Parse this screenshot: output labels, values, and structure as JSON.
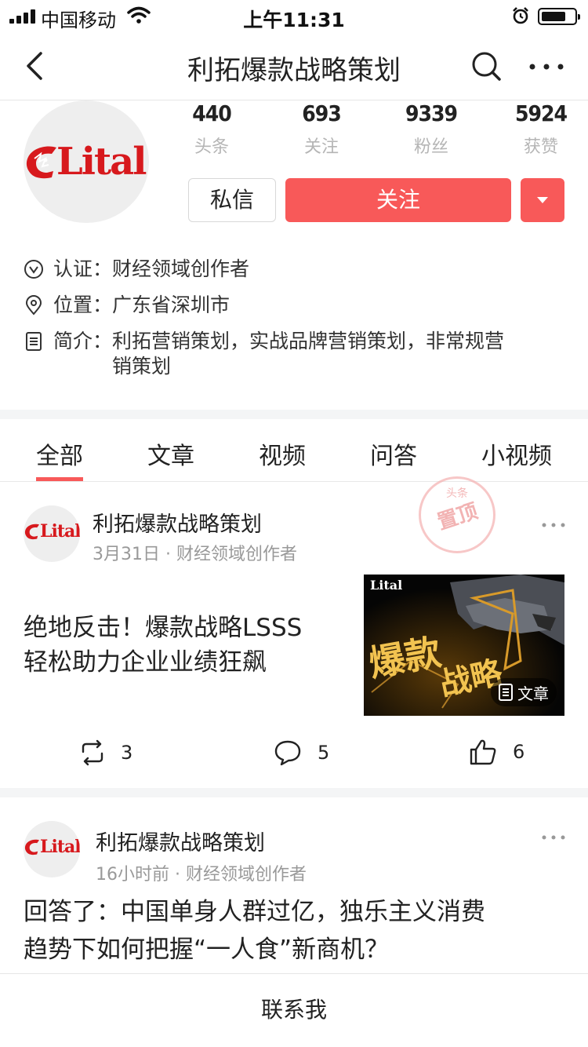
{
  "status_bar": {
    "carrier": "中国移动",
    "time": "上午11:31"
  },
  "nav": {
    "title": "利拓爆款战略策划"
  },
  "profile": {
    "logo_text": "Lital",
    "stats": [
      {
        "value": "440",
        "label": "头条"
      },
      {
        "value": "693",
        "label": "关注"
      },
      {
        "value": "9339",
        "label": "粉丝"
      },
      {
        "value": "5924",
        "label": "获赞"
      }
    ],
    "message_button": "私信",
    "follow_button": "关注",
    "info": {
      "cert_key": "认证：",
      "cert_val": "财经领域创作者",
      "loc_key": "位置：",
      "loc_val": "广东省深圳市",
      "intro_key": "简介：",
      "intro_val": "利拓营销策划，实战品牌营销策划，非常规营销策划"
    }
  },
  "tabs": [
    "全部",
    "文章",
    "视频",
    "问答",
    "小视频"
  ],
  "posts": [
    {
      "author": "利拓爆款战略策划",
      "date": "3月31日",
      "meta": "财经领域创作者",
      "pin_small": "头条",
      "pin_big": "置顶",
      "headline_line1": "绝地反击！爆款战略LSSS",
      "headline_line2": "轻松助力企业业绩狂飙",
      "thumb_logo": "Lital",
      "thumb_text1": "爆款",
      "thumb_text2": "战略",
      "thumb_badge": "文章",
      "repost_count": "3",
      "comment_count": "5",
      "like_count": "6"
    },
    {
      "author": "利拓爆款战略策划",
      "date": "16小时前",
      "meta": "财经领域创作者",
      "headline_line1": "回答了：中国单身人群过亿，独乐主义消费",
      "headline_line2": "趋势下如何把握“一人食”新商机？"
    }
  ],
  "bottom_bar": {
    "label": "联系我"
  },
  "colors": {
    "accent": "#f85959",
    "brand_red": "#d7191d"
  }
}
